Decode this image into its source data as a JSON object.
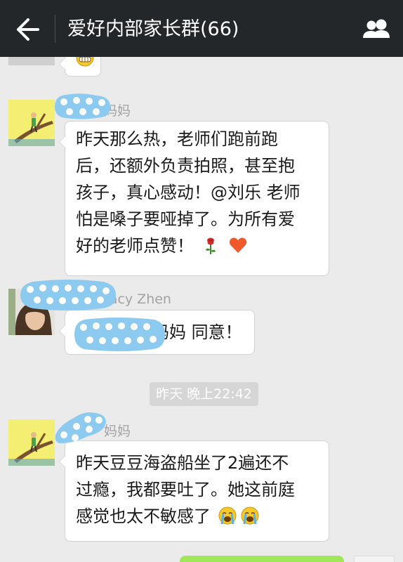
{
  "header": {
    "back_icon": "arrow-left-icon",
    "title": "爱好内部家长群(66)",
    "members_icon": "group-members-icon"
  },
  "messages": [
    {
      "sender": "妈妈",
      "text_lines": [
        "昨天那么热，老师们跑前跑",
        "后，还额外负责拍照，甚至抱",
        "孩子，真心感动！@刘乐 老师",
        "怕是嗓子要哑掉了。为所有爱",
        "好的老师点赞！"
      ],
      "trailing_emojis": [
        "rose-icon",
        "heart-icon"
      ]
    },
    {
      "sender": "racy Zhen",
      "text": "妈妈 同意！"
    },
    {
      "sender": "妈妈",
      "text_lines": [
        "昨天豆豆海盗船坐了2遍还不",
        "过瘾，我都要吐了。她这前庭",
        "感觉也太不敏感了"
      ],
      "trailing_emojis": [
        "crying-face-icon",
        "crying-face-icon"
      ]
    }
  ],
  "timestamp": "昨天 晚上22:42",
  "colors": {
    "topbar": "#23272a",
    "background": "#ebebeb",
    "bubble": "#ffffff",
    "sent_bubble": "#a0e75a",
    "heart": "#f1592a",
    "sticker_blue": "#8ccaf0"
  }
}
